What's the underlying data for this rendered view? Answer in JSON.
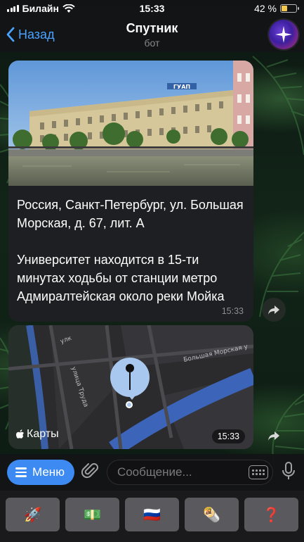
{
  "status_bar": {
    "carrier": "Билайн",
    "time": "15:33",
    "battery_percent": "42 %",
    "battery_level": 0.42
  },
  "header": {
    "back_label": "Назад",
    "title": "Спутник",
    "subtitle": "бот"
  },
  "messages": [
    {
      "type": "photo_text",
      "text": "Россия, Санкт-Петербург, ул. Большая Морская, д. 67, лит. А\n\nУниверситет находится в 15-ти минутах ходьбы от станции метро Адмиралтейская около реки Мойка",
      "time": "15:33",
      "photo_sign": "ГУАП"
    },
    {
      "type": "location",
      "map_brand": "Карты",
      "time": "15:33",
      "street_labels": [
        "Большая Морская у",
        "улица Труда",
        "улк"
      ]
    }
  ],
  "input_bar": {
    "menu_label": "Меню",
    "placeholder": "Сообщение..."
  },
  "keyboard": {
    "buttons": [
      "🚀",
      "💵",
      "🇷🇺",
      "🌯",
      "❓"
    ]
  },
  "colors": {
    "accent": "#3d8bf2",
    "link": "#4aa3ff",
    "bubble": "#1e1f22",
    "battery": "#f2c94c",
    "pin": "#a9c8ef"
  }
}
